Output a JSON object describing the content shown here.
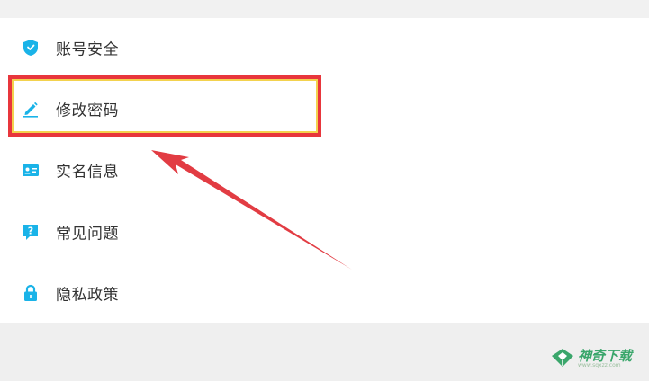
{
  "menu": {
    "items": [
      {
        "label": "账号安全",
        "icon": "shield-icon"
      },
      {
        "label": "修改密码",
        "icon": "pencil-icon"
      },
      {
        "label": "实名信息",
        "icon": "id-card-icon"
      },
      {
        "label": "常见问题",
        "icon": "question-icon"
      },
      {
        "label": "隐私政策",
        "icon": "lock-icon"
      }
    ],
    "highlighted_item": "修改密码"
  },
  "colors": {
    "icon_accent": "#1ab3e8",
    "highlight_border": "#e8363c",
    "arrow": "#e23c43",
    "watermark": "#3aa66b"
  },
  "watermark": {
    "text": "神奇下载",
    "subtext": "www.sqxzz.com"
  }
}
